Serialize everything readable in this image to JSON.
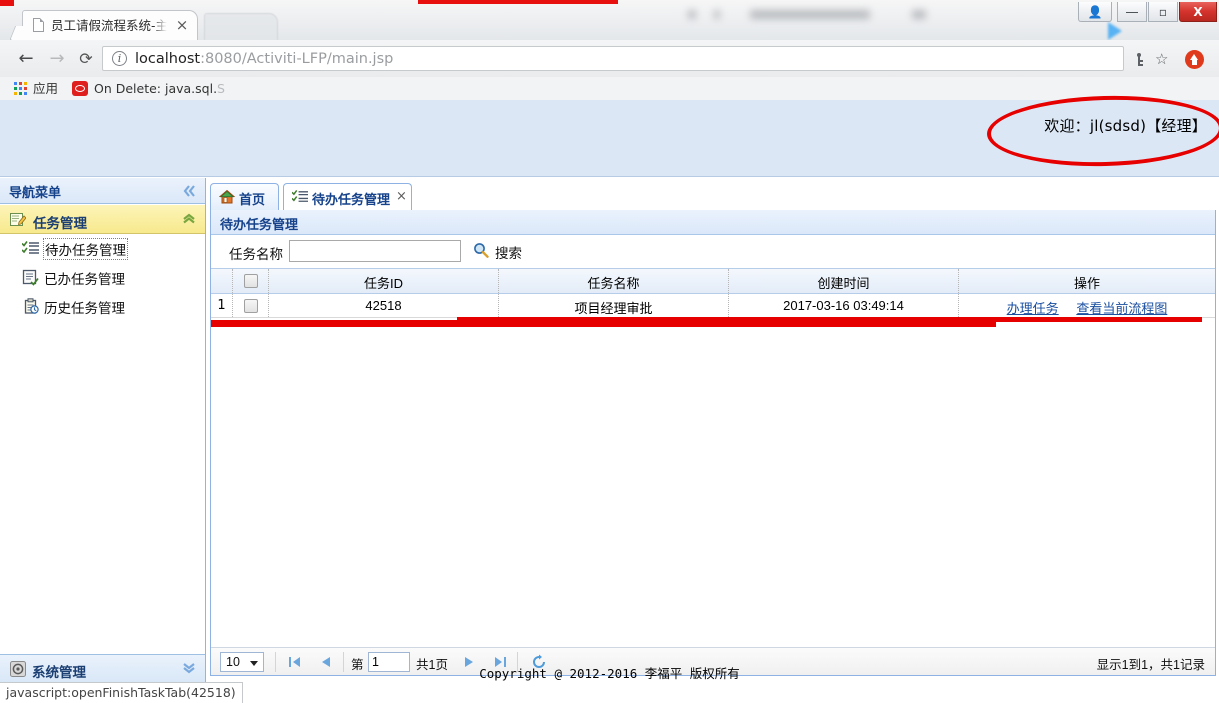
{
  "browser": {
    "tab_title": "员工请假流程系统-主页面",
    "tab_close": "×",
    "url_prefix": "localhost",
    "url_rest": ":8080/Activiti-LFP/main.jsp",
    "nav": {
      "back": "←",
      "forward": "→",
      "reload": "⟳"
    },
    "bookmarks": {
      "apps_label": "应用",
      "item1_label": "On Delete: java.sql.",
      "item1_faded": "S"
    },
    "window": {
      "user": "",
      "minimize": "―",
      "maximize": "▫",
      "close": "X"
    }
  },
  "header": {
    "welcome": "欢迎：jl(sdsd)【经理】"
  },
  "sidebar": {
    "title": "导航菜单",
    "collapse_icon": "chevron-double-left-icon",
    "group": {
      "label": "任务管理",
      "toggle_icon": "chevron-double-up-icon"
    },
    "items": [
      {
        "label": "待办任务管理",
        "icon": "checklist-icon",
        "selected": true
      },
      {
        "label": "已办任务管理",
        "icon": "document-check-icon",
        "selected": false
      },
      {
        "label": "历史任务管理",
        "icon": "clipboard-clock-icon",
        "selected": false
      }
    ],
    "bottom": {
      "label": "系统管理",
      "icon": "gear-icon",
      "toggle_icon": "chevron-double-down-icon"
    }
  },
  "content": {
    "tabs": [
      {
        "label": "首页",
        "icon": "home-icon",
        "active": false,
        "closable": false
      },
      {
        "label": "待办任务管理",
        "icon": "checklist-icon",
        "active": true,
        "closable": true,
        "close": "×"
      }
    ],
    "panel_title": "待办任务管理",
    "search": {
      "label": "任务名称",
      "value": "",
      "placeholder": "",
      "button_label": "搜索",
      "button_icon": "magnifier-icon"
    },
    "grid": {
      "columns": [
        "",
        "",
        "任务ID",
        "任务名称",
        "创建时间",
        "操作"
      ],
      "rows": [
        {
          "index": "1",
          "task_id": "42518",
          "task_name": "项目经理审批",
          "create_time": "2017-03-16 03:49:14",
          "actions": [
            "办理任务",
            "查看当前流程图"
          ]
        }
      ]
    },
    "pager": {
      "page_size": "10",
      "first_icon": "first-page-icon",
      "prev_icon": "prev-page-icon",
      "prefix": "第",
      "page_value": "1",
      "suffix": "共1页",
      "next_icon": "next-page-icon",
      "last_icon": "last-page-icon",
      "refresh_icon": "refresh-icon",
      "info": "显示1到1，共1记录"
    }
  },
  "footer": {
    "copyright": "Copyright @ 2012-2016 李福平 版权所有"
  },
  "status": {
    "link_target": "javascript:openFinishTaskTab(42518)"
  },
  "colors": {
    "accent_blue": "#15428b",
    "header_band": "#dce7f6",
    "group_yellow": "#f7e98d",
    "annotation_red": "#e60000",
    "link_blue": "#1a4fa0"
  }
}
